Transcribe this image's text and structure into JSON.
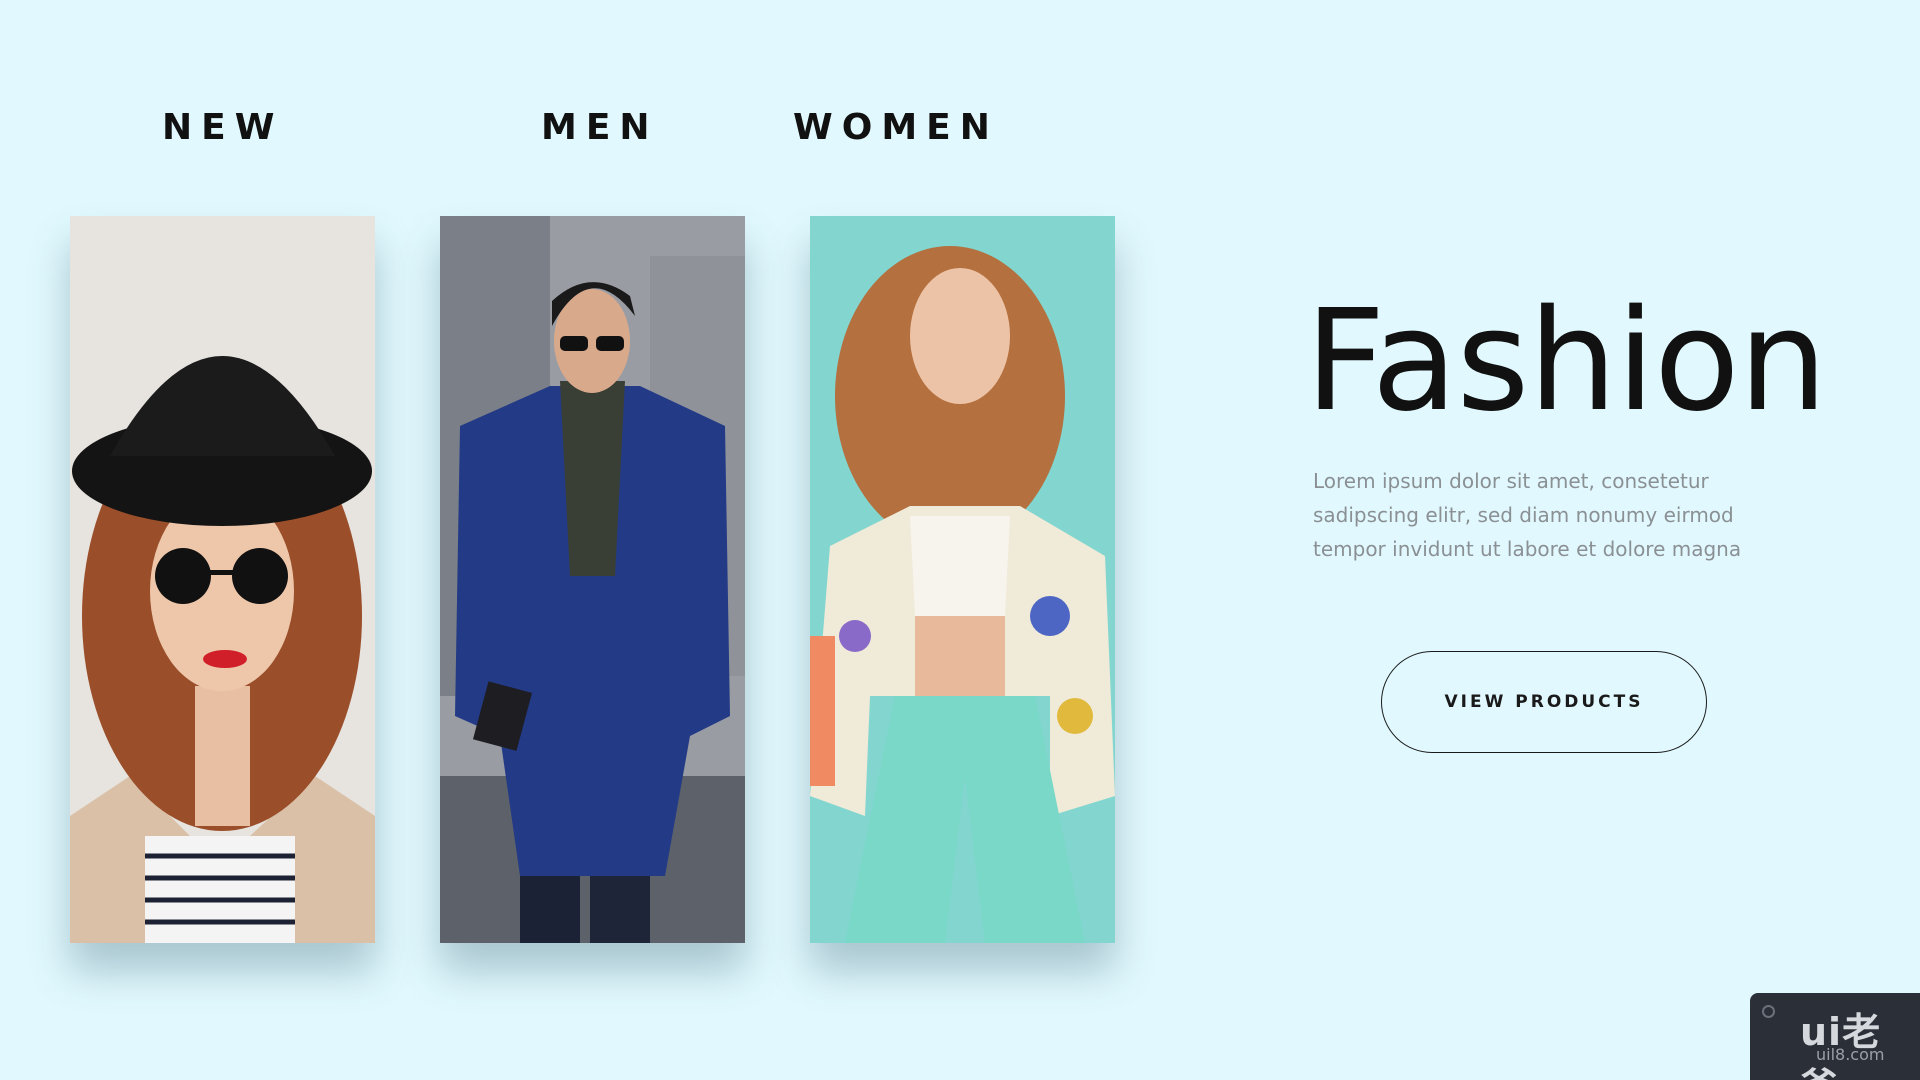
{
  "nav": {
    "items": [
      {
        "label": "NEW"
      },
      {
        "label": "MEN"
      },
      {
        "label": "WOMEN"
      }
    ]
  },
  "cards": [
    {
      "category": "NEW",
      "image": "woman-hat-sunglasses-photo"
    },
    {
      "category": "MEN",
      "image": "man-blue-coat-photo"
    },
    {
      "category": "WOMEN",
      "image": "woman-floral-jacket-photo"
    }
  ],
  "hero": {
    "title": "Fashion",
    "description": "Lorem ipsum dolor sit amet, consetetur sadipscing elitr, sed diam nonumy eirmod tempor invidunt ut labore et dolore magna",
    "cta_label": "VIEW PRODUCTS"
  },
  "watermark": {
    "logo": "ui老爸",
    "url": "uil8.com"
  },
  "colors": {
    "background": "#e1f9fe",
    "text": "#111111",
    "muted_text": "#8a9094"
  }
}
